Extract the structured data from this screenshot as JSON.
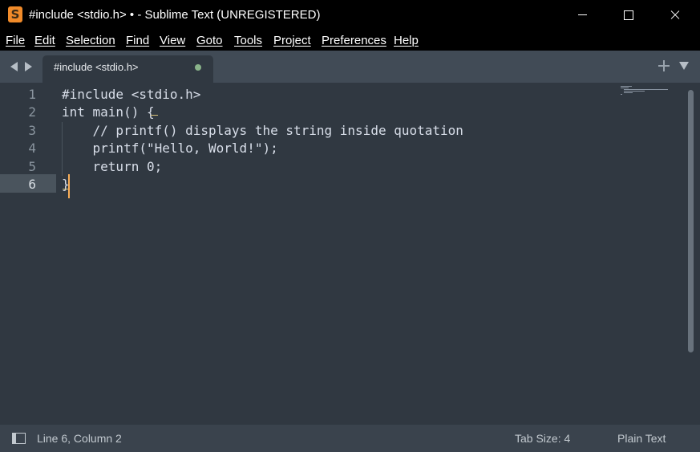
{
  "window": {
    "title": "#include <stdio.h> • - Sublime Text (UNREGISTERED)",
    "accent_color": "#f18b2a"
  },
  "menu": {
    "items": [
      {
        "label": "File"
      },
      {
        "label": "Edit"
      },
      {
        "label": "Selection"
      },
      {
        "label": "Find"
      },
      {
        "label": "View"
      },
      {
        "label": "Goto"
      },
      {
        "label": "Tools"
      },
      {
        "label": "Project"
      },
      {
        "label": "Preferences"
      },
      {
        "label": "Help"
      }
    ]
  },
  "tabs": [
    {
      "label": "#include <stdio.h>",
      "modified": true,
      "active": true
    }
  ],
  "editor": {
    "current_line": 6,
    "lines": [
      {
        "number": "1",
        "text": "#include <stdio.h>"
      },
      {
        "number": "2",
        "text": "int main() {"
      },
      {
        "number": "3",
        "text": "    // printf() displays the string inside quotation"
      },
      {
        "number": "4",
        "text": "    printf(\"Hello, World!\");"
      },
      {
        "number": "5",
        "text": "    return 0;"
      },
      {
        "number": "6",
        "text": "}"
      }
    ]
  },
  "status": {
    "position": "Line 6, Column 2",
    "tab_size": "Tab Size: 4",
    "syntax": "Plain Text"
  }
}
